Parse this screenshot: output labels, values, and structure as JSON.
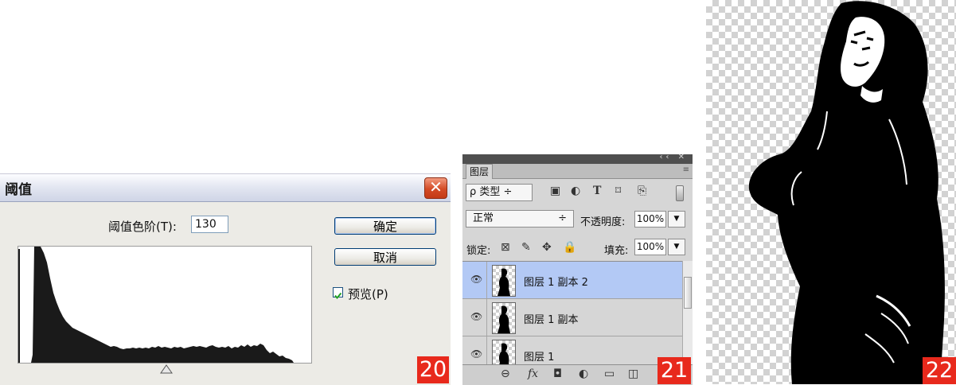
{
  "threshold_dialog": {
    "title": "阈值",
    "close_glyph": "✕",
    "level_label": "阈值色阶(T):",
    "level_value": "130",
    "ok_label": "确定",
    "cancel_label": "取消",
    "preview_checked": true,
    "preview_label": "预览(P)",
    "figure_number": "20"
  },
  "layers_panel": {
    "top_icons": "‹‹ ✕",
    "tab_label": "图层",
    "menu_icon": "≡",
    "filter_kind": "ρ 类型 ÷",
    "filter_icons": [
      "image-filter-icon",
      "adjustment-filter-icon",
      "type-filter-icon",
      "shape-filter-icon",
      "smartobject-filter-icon"
    ],
    "blend_mode": "正常",
    "blend_arrow": "÷",
    "opacity_label": "不透明度:",
    "opacity_value": "100%",
    "lock_label": "锁定:",
    "fill_label": "填充:",
    "fill_value": "100%",
    "dropdown_glyph": "▼",
    "layers": [
      {
        "name": "图层 1 副本 2",
        "selected": true
      },
      {
        "name": "图层 1 副本",
        "selected": false
      },
      {
        "name": "图层 1",
        "selected": false
      }
    ],
    "figure_number": "21"
  },
  "result_image": {
    "figure_number": "22"
  },
  "colors": {
    "badge": "#e8291c",
    "selected_layer": "#b3c9f5",
    "close_button": "#d34a25"
  }
}
